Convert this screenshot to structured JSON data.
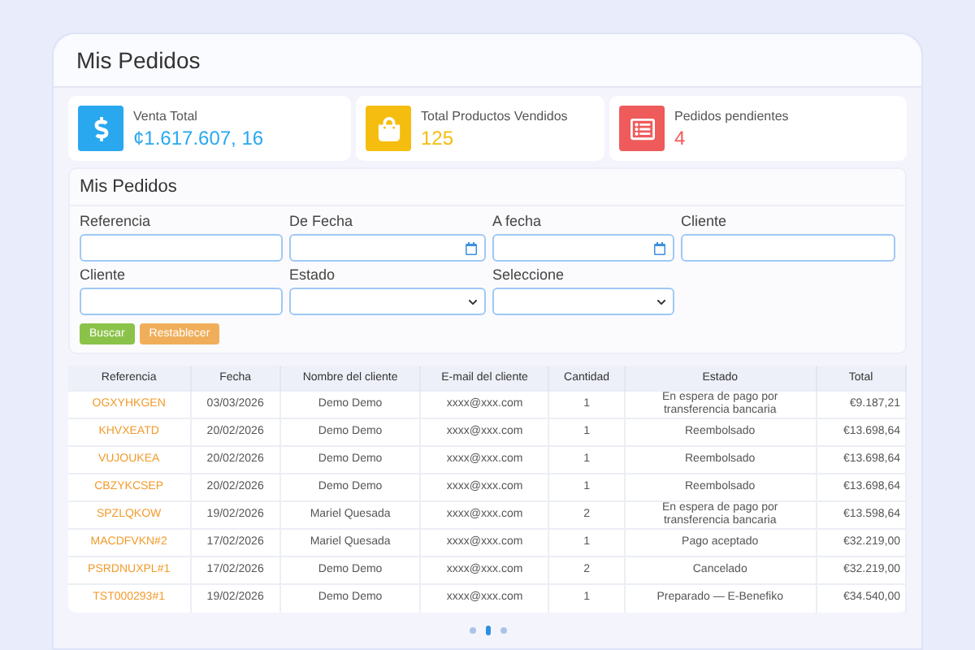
{
  "page_title": "Mis Pedidos",
  "stats": [
    {
      "kind": "money",
      "label": "Venta Total",
      "value": "¢1.617.607, 16",
      "color": "#29a8ef"
    },
    {
      "kind": "bag",
      "label": "Total Productos Vendidos",
      "value": "125",
      "color": "#f5bd0f"
    },
    {
      "kind": "list",
      "label": "Pedidos pendientes",
      "value": "4",
      "color": "#ef5b5b"
    }
  ],
  "filter_panel": {
    "title": "Mis Pedidos",
    "fields": [
      {
        "kind": "text",
        "label": "Referencia"
      },
      {
        "kind": "date",
        "label": "De Fecha"
      },
      {
        "kind": "date",
        "label": "A fecha"
      },
      {
        "kind": "text",
        "label": "Cliente"
      },
      {
        "kind": "text",
        "label": "Cliente"
      },
      {
        "kind": "select",
        "label": "Estado"
      },
      {
        "kind": "select",
        "label": "Seleccione"
      }
    ],
    "buttons": [
      {
        "label": "Buscar",
        "kind": "primary"
      },
      {
        "label": "Restablecer",
        "kind": "secondary"
      }
    ]
  },
  "table": {
    "columns": [
      "Referencia",
      "Fecha",
      "Nombre del cliente",
      "E-mail del cliente",
      "Cantidad",
      "Estado",
      "Total"
    ],
    "rows": [
      [
        "OGXYHKGEN",
        "03/03/2026",
        "Demo Demo",
        "xxxx@xxx.com",
        "1",
        "En espera de pago por transferencia bancaria",
        "€9.187,21"
      ],
      [
        "KHVXEATD",
        "20/02/2026",
        "Demo Demo",
        "xxxx@xxx.com",
        "1",
        "Reembolsado",
        "€13.698,64"
      ],
      [
        "VUJOUKEA",
        "20/02/2026",
        "Demo Demo",
        "xxxx@xxx.com",
        "1",
        "Reembolsado",
        "€13.698,64"
      ],
      [
        "CBZYKCSEP",
        "20/02/2026",
        "Demo Demo",
        "xxxx@xxx.com",
        "1",
        "Reembolsado",
        "€13.698,64"
      ],
      [
        "SPZLQKOW",
        "19/02/2026",
        "Mariel Quesada",
        "xxxx@xxx.com",
        "2",
        "En espera de pago por transferencia bancaria",
        "€13.598,64"
      ],
      [
        "MACDFVKN#2",
        "17/02/2026",
        "Mariel Quesada",
        "xxxx@xxx.com",
        "1",
        "Pago aceptado",
        "€32.219,00"
      ],
      [
        "PSRDNUXPL#1",
        "17/02/2026",
        "Demo Demo",
        "xxxx@xxx.com",
        "2",
        "Cancelado",
        "€32.219,00"
      ],
      [
        "TST000293#1",
        "19/02/2026",
        "Demo Demo",
        "xxxx@xxx.com",
        "1",
        "Preparado — E-Benefiko",
        "€34.540,00"
      ]
    ]
  },
  "pagination": [
    {
      "selected": false
    },
    {
      "selected": true
    },
    {
      "selected": false
    }
  ]
}
